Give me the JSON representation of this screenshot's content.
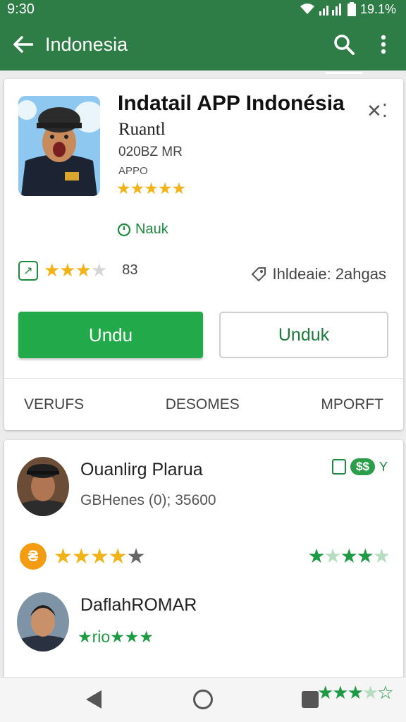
{
  "status_bar": {
    "time": "9:30",
    "battery": "19.1%"
  },
  "app_bar": {
    "title": "Indonesia",
    "icons": [
      "back-arrow-icon",
      "search-icon",
      "more-vert-icon"
    ]
  },
  "app": {
    "title": "Indatail APP Indonésia",
    "subtitle": "Ruantl",
    "meta1": "020BZ MR",
    "meta2": "APPO",
    "header_rating": "★★★★★",
    "install_status": "Nauk",
    "rating_count": "83",
    "category": "Ihldeaie: 2ahgas",
    "primary_button": "Undu",
    "secondary_button": "Unduk",
    "tabs": [
      "VERUFS",
      "DESOMES",
      "MPORFT"
    ]
  },
  "reviews": [
    {
      "name": "Ouanlirg Plarua",
      "meta": "GBHenes (0); 35600",
      "badge": "$$",
      "badge_suffix": "Y",
      "rating_stars": "★★★★",
      "rating_empty": "★"
    },
    {
      "name": "DaflahROMAR",
      "inline_stars": "★rio★★★"
    }
  ],
  "colors": {
    "primary": "#2e7d47",
    "accent": "#22a949",
    "star": "#f2b318"
  }
}
